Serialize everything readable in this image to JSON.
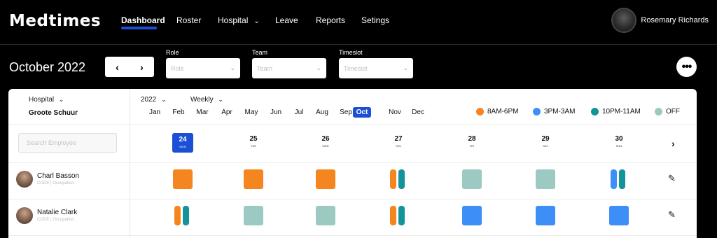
{
  "app": {
    "logo": "Medtimes"
  },
  "nav": {
    "items": [
      "Dashboard",
      "Roster",
      "Hospital",
      "Leave",
      "Reports",
      "Setings"
    ],
    "active": "Dashboard",
    "hospital_has_dropdown": true
  },
  "user": {
    "name": "Rosemary Richards"
  },
  "toolbar": {
    "month_title": "October 2022",
    "prev_label": "‹",
    "next_label": "›",
    "filters": [
      {
        "label": "Role",
        "placeholder": "Role"
      },
      {
        "label": "Team",
        "placeholder": "Team"
      },
      {
        "label": "Timeslot",
        "placeholder": "Timeslot"
      }
    ],
    "more_label": "•••"
  },
  "roster": {
    "hospital_label": "Hospital",
    "hospital_value": "Groote Schuur",
    "year": "2022",
    "period": "Weekly",
    "months": [
      "Jan",
      "Feb",
      "Mar",
      "Apr",
      "May",
      "Jun",
      "Jul",
      "Aug",
      "Sep",
      "Oct",
      "Nov",
      "Dec"
    ],
    "active_month": "Oct",
    "legend": [
      {
        "label": "8AM-6PM",
        "color": "#f5861f"
      },
      {
        "label": "3PM-3AM",
        "color": "#3d8ef7"
      },
      {
        "label": "10PM-11AM",
        "color": "#13939a"
      },
      {
        "label": "OFF",
        "color": "#9ccac3"
      }
    ],
    "search_placeholder": "Search Employee",
    "days": [
      {
        "num": "24",
        "dow": "MON",
        "today": true
      },
      {
        "num": "25",
        "dow": "TUE"
      },
      {
        "num": "26",
        "dow": "WED"
      },
      {
        "num": "27",
        "dow": "THU"
      },
      {
        "num": "28",
        "dow": "FRI"
      },
      {
        "num": "29",
        "dow": "SAT"
      },
      {
        "num": "30",
        "dow": "SUN"
      }
    ],
    "employees": [
      {
        "name": "Charl Basson",
        "role": "CODE | Occupation",
        "shifts": [
          [
            "8AM-6PM"
          ],
          [
            "8AM-6PM"
          ],
          [
            "8AM-6PM"
          ],
          [
            "8AM-6PM",
            "10PM-11AM"
          ],
          [
            "OFF"
          ],
          [
            "OFF"
          ],
          [
            "3PM-3AM",
            "10PM-11AM"
          ]
        ]
      },
      {
        "name": "Natalie Clark",
        "role": "CODE | Occupation",
        "shifts": [
          [
            "8AM-6PM",
            "10PM-11AM"
          ],
          [
            "OFF"
          ],
          [
            "OFF"
          ],
          [
            "8AM-6PM",
            "10PM-11AM"
          ],
          [
            "3PM-3AM"
          ],
          [
            "3PM-3AM"
          ],
          [
            "3PM-3AM"
          ]
        ]
      }
    ]
  }
}
